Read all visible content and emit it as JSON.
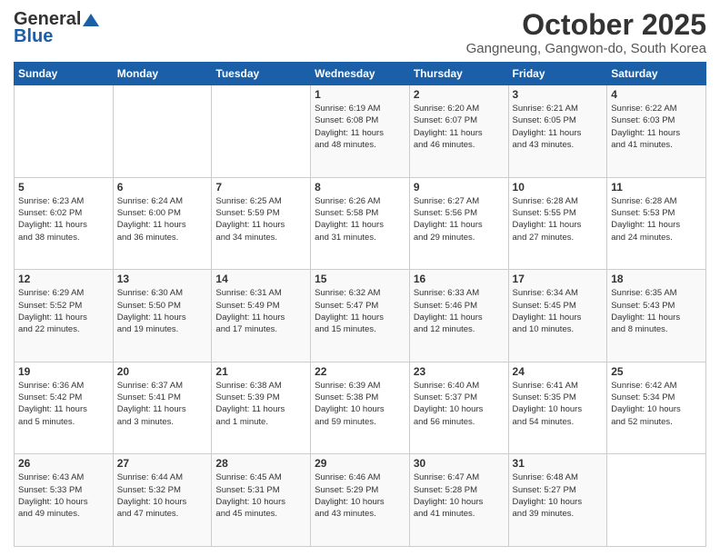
{
  "logo": {
    "line1": "General",
    "line2": "Blue"
  },
  "title": "October 2025",
  "subtitle": "Gangneung, Gangwon-do, South Korea",
  "headers": [
    "Sunday",
    "Monday",
    "Tuesday",
    "Wednesday",
    "Thursday",
    "Friday",
    "Saturday"
  ],
  "weeks": [
    [
      {
        "day": "",
        "info": ""
      },
      {
        "day": "",
        "info": ""
      },
      {
        "day": "",
        "info": ""
      },
      {
        "day": "1",
        "info": "Sunrise: 6:19 AM\nSunset: 6:08 PM\nDaylight: 11 hours\nand 48 minutes."
      },
      {
        "day": "2",
        "info": "Sunrise: 6:20 AM\nSunset: 6:07 PM\nDaylight: 11 hours\nand 46 minutes."
      },
      {
        "day": "3",
        "info": "Sunrise: 6:21 AM\nSunset: 6:05 PM\nDaylight: 11 hours\nand 43 minutes."
      },
      {
        "day": "4",
        "info": "Sunrise: 6:22 AM\nSunset: 6:03 PM\nDaylight: 11 hours\nand 41 minutes."
      }
    ],
    [
      {
        "day": "5",
        "info": "Sunrise: 6:23 AM\nSunset: 6:02 PM\nDaylight: 11 hours\nand 38 minutes."
      },
      {
        "day": "6",
        "info": "Sunrise: 6:24 AM\nSunset: 6:00 PM\nDaylight: 11 hours\nand 36 minutes."
      },
      {
        "day": "7",
        "info": "Sunrise: 6:25 AM\nSunset: 5:59 PM\nDaylight: 11 hours\nand 34 minutes."
      },
      {
        "day": "8",
        "info": "Sunrise: 6:26 AM\nSunset: 5:58 PM\nDaylight: 11 hours\nand 31 minutes."
      },
      {
        "day": "9",
        "info": "Sunrise: 6:27 AM\nSunset: 5:56 PM\nDaylight: 11 hours\nand 29 minutes."
      },
      {
        "day": "10",
        "info": "Sunrise: 6:28 AM\nSunset: 5:55 PM\nDaylight: 11 hours\nand 27 minutes."
      },
      {
        "day": "11",
        "info": "Sunrise: 6:28 AM\nSunset: 5:53 PM\nDaylight: 11 hours\nand 24 minutes."
      }
    ],
    [
      {
        "day": "12",
        "info": "Sunrise: 6:29 AM\nSunset: 5:52 PM\nDaylight: 11 hours\nand 22 minutes."
      },
      {
        "day": "13",
        "info": "Sunrise: 6:30 AM\nSunset: 5:50 PM\nDaylight: 11 hours\nand 19 minutes."
      },
      {
        "day": "14",
        "info": "Sunrise: 6:31 AM\nSunset: 5:49 PM\nDaylight: 11 hours\nand 17 minutes."
      },
      {
        "day": "15",
        "info": "Sunrise: 6:32 AM\nSunset: 5:47 PM\nDaylight: 11 hours\nand 15 minutes."
      },
      {
        "day": "16",
        "info": "Sunrise: 6:33 AM\nSunset: 5:46 PM\nDaylight: 11 hours\nand 12 minutes."
      },
      {
        "day": "17",
        "info": "Sunrise: 6:34 AM\nSunset: 5:45 PM\nDaylight: 11 hours\nand 10 minutes."
      },
      {
        "day": "18",
        "info": "Sunrise: 6:35 AM\nSunset: 5:43 PM\nDaylight: 11 hours\nand 8 minutes."
      }
    ],
    [
      {
        "day": "19",
        "info": "Sunrise: 6:36 AM\nSunset: 5:42 PM\nDaylight: 11 hours\nand 5 minutes."
      },
      {
        "day": "20",
        "info": "Sunrise: 6:37 AM\nSunset: 5:41 PM\nDaylight: 11 hours\nand 3 minutes."
      },
      {
        "day": "21",
        "info": "Sunrise: 6:38 AM\nSunset: 5:39 PM\nDaylight: 11 hours\nand 1 minute."
      },
      {
        "day": "22",
        "info": "Sunrise: 6:39 AM\nSunset: 5:38 PM\nDaylight: 10 hours\nand 59 minutes."
      },
      {
        "day": "23",
        "info": "Sunrise: 6:40 AM\nSunset: 5:37 PM\nDaylight: 10 hours\nand 56 minutes."
      },
      {
        "day": "24",
        "info": "Sunrise: 6:41 AM\nSunset: 5:35 PM\nDaylight: 10 hours\nand 54 minutes."
      },
      {
        "day": "25",
        "info": "Sunrise: 6:42 AM\nSunset: 5:34 PM\nDaylight: 10 hours\nand 52 minutes."
      }
    ],
    [
      {
        "day": "26",
        "info": "Sunrise: 6:43 AM\nSunset: 5:33 PM\nDaylight: 10 hours\nand 49 minutes."
      },
      {
        "day": "27",
        "info": "Sunrise: 6:44 AM\nSunset: 5:32 PM\nDaylight: 10 hours\nand 47 minutes."
      },
      {
        "day": "28",
        "info": "Sunrise: 6:45 AM\nSunset: 5:31 PM\nDaylight: 10 hours\nand 45 minutes."
      },
      {
        "day": "29",
        "info": "Sunrise: 6:46 AM\nSunset: 5:29 PM\nDaylight: 10 hours\nand 43 minutes."
      },
      {
        "day": "30",
        "info": "Sunrise: 6:47 AM\nSunset: 5:28 PM\nDaylight: 10 hours\nand 41 minutes."
      },
      {
        "day": "31",
        "info": "Sunrise: 6:48 AM\nSunset: 5:27 PM\nDaylight: 10 hours\nand 39 minutes."
      },
      {
        "day": "",
        "info": ""
      }
    ]
  ]
}
